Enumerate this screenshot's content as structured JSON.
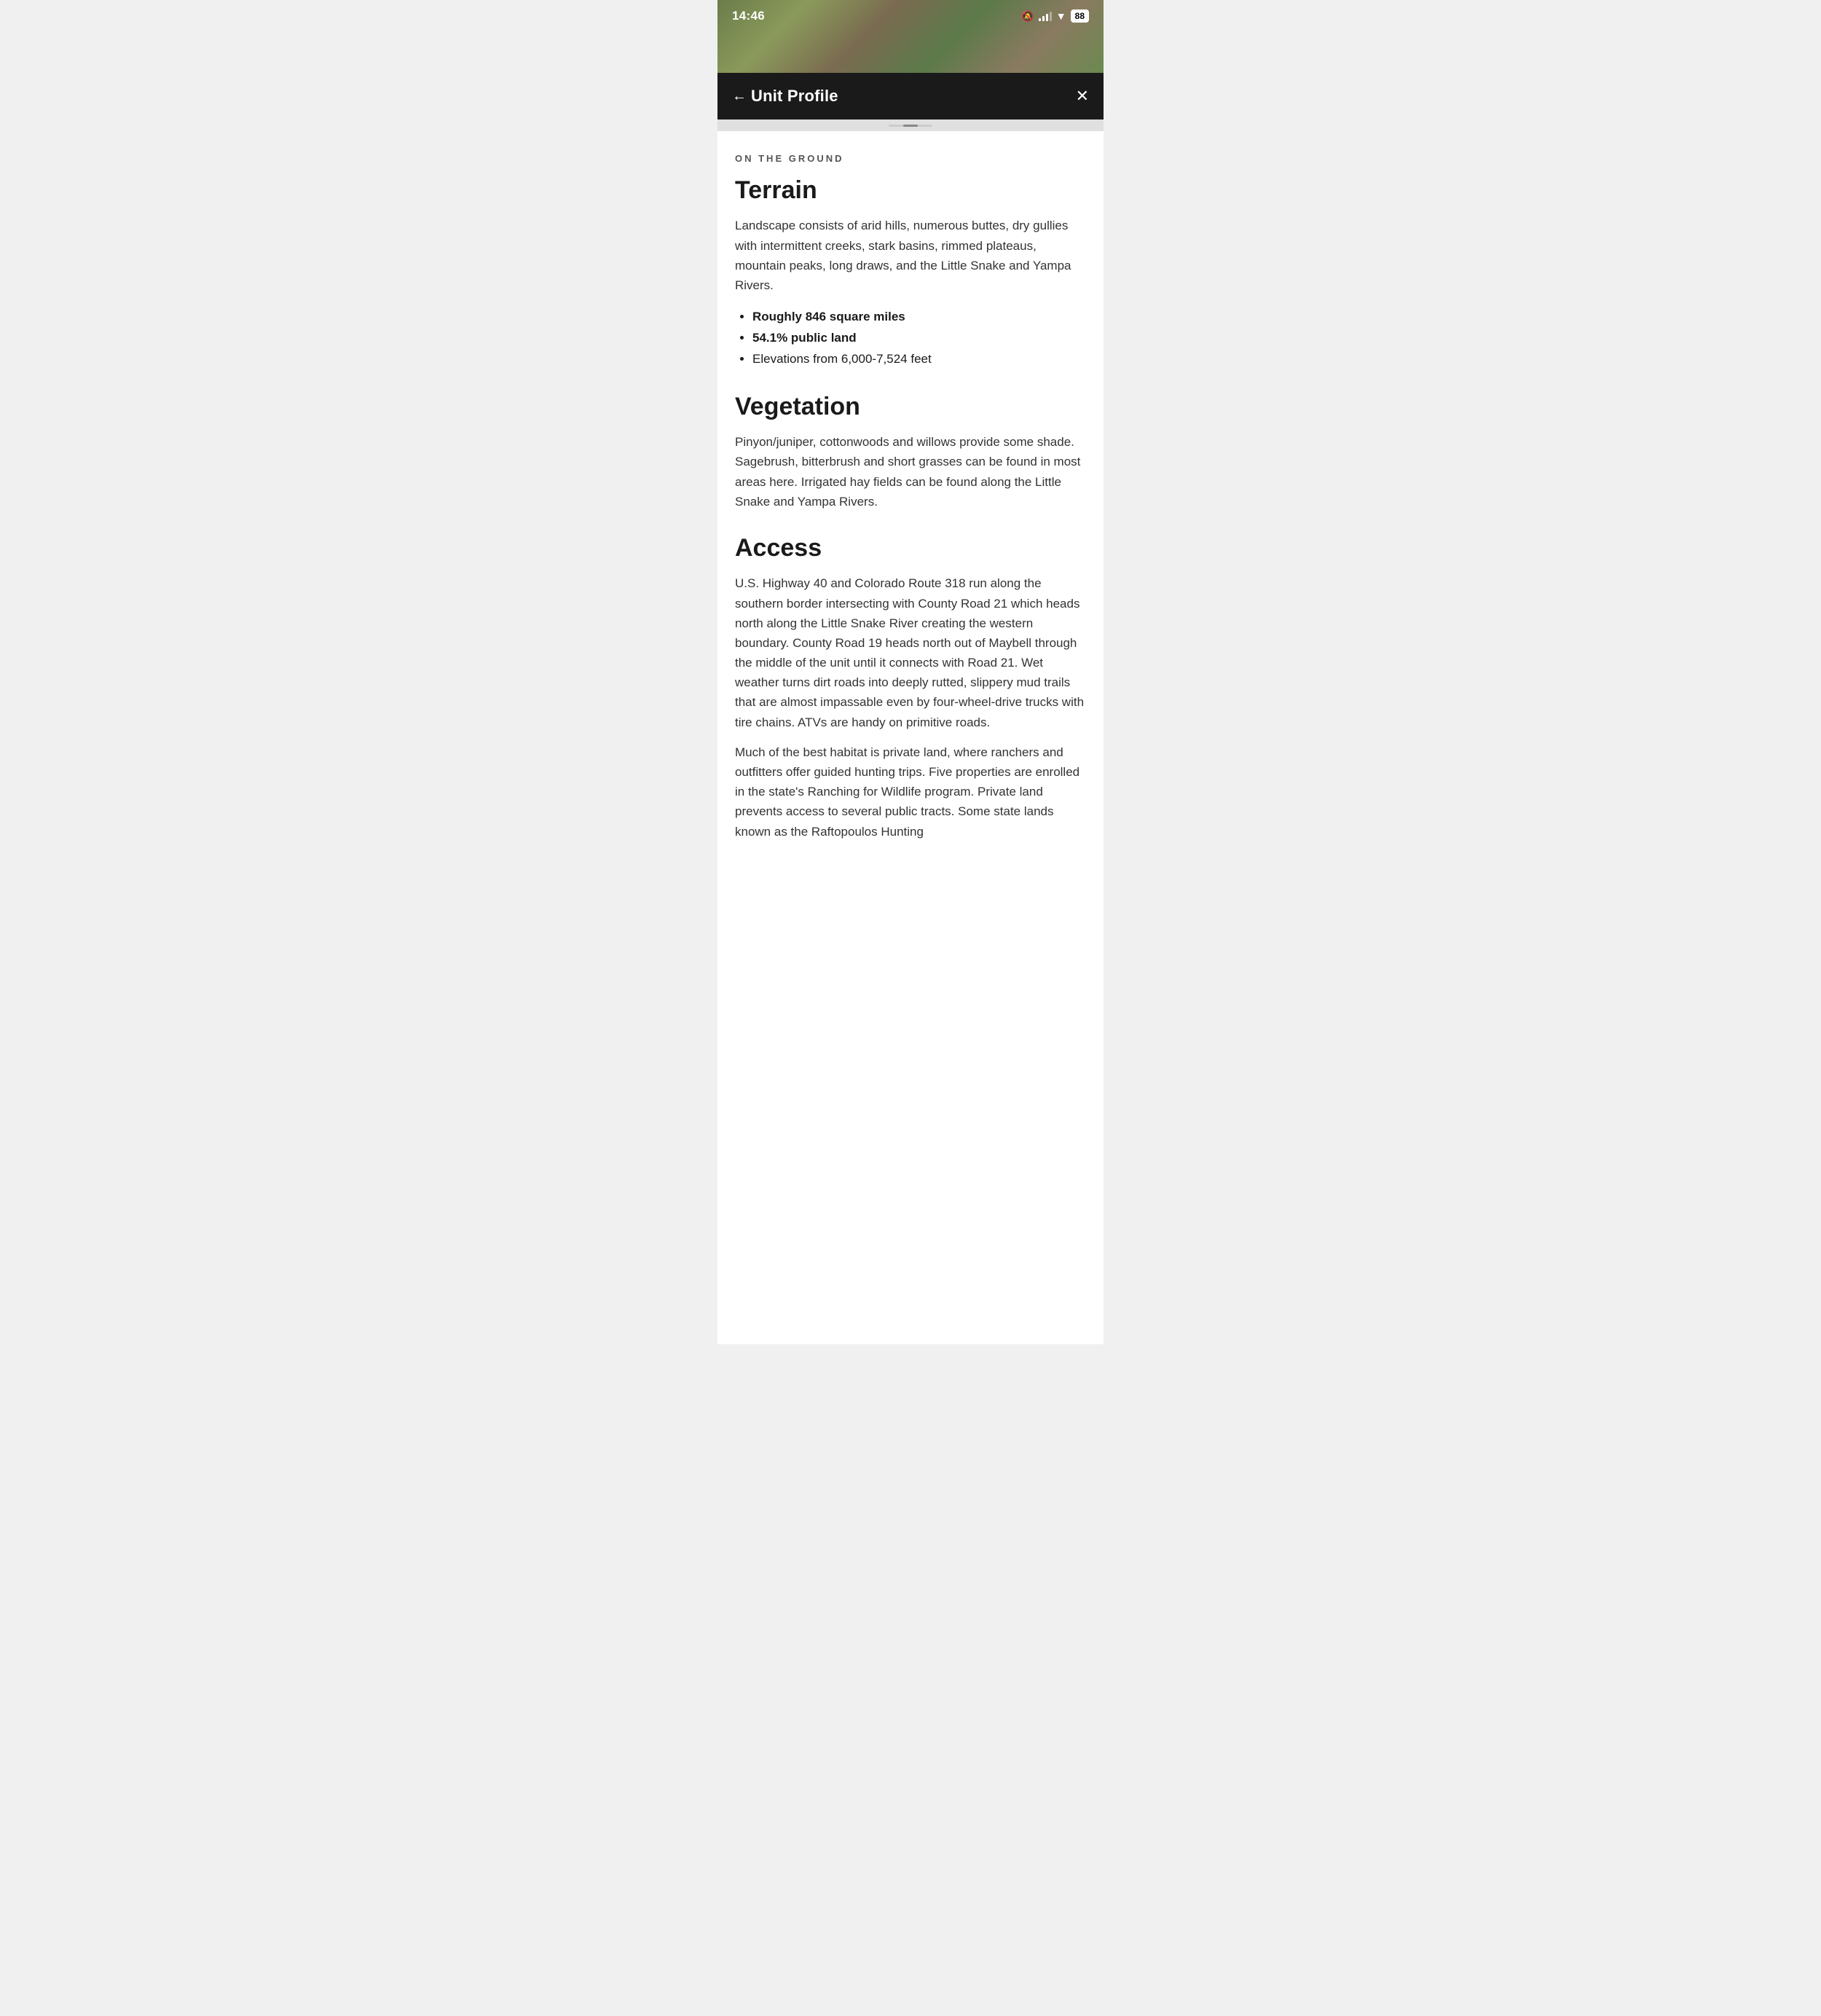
{
  "statusBar": {
    "time": "14:46",
    "batteryLevel": "88",
    "bellIcon": "🔕",
    "wifiIcon": "📶"
  },
  "navBar": {
    "backLabel": "Unit Profile",
    "backIcon": "←",
    "closeIcon": "✕"
  },
  "sectionLabel": "ON THE GROUND",
  "terrain": {
    "heading": "Terrain",
    "description": "Landscape consists of arid hills, numerous buttes, dry gullies with intermittent creeks, stark basins, rimmed plateaus, mountain peaks, long draws, and  the Little Snake and Yampa Rivers.",
    "bullets": [
      "Roughly 846 square miles",
      "54.1% public land",
      "Elevations from 6,000-7,524 feet"
    ]
  },
  "vegetation": {
    "heading": "Vegetation",
    "description": "Pinyon/juniper, cottonwoods and willows provide some shade. Sagebrush, bitterbrush and short grasses can be found in most areas here. Irrigated hay fields can be found along the Little Snake and Yampa Rivers."
  },
  "access": {
    "heading": "Access",
    "paragraph1": "U.S. Highway 40 and Colorado Route 318 run along the southern border intersecting with County Road 21 which heads north along the Little Snake River creating the western boundary. County Road 19 heads north out of Maybell through the middle of the unit until it connects with Road 21. Wet weather turns dirt roads into deeply rutted, slippery mud trails that are almost impassable even by four-wheel-drive trucks with tire chains. ATVs are handy on primitive roads.",
    "paragraph2": "Much of the best habitat is private land, where ranchers and outfitters offer guided hunting trips. Five properties are enrolled in the state's Ranching for Wildlife program. Private land prevents access to several public tracts. Some state lands known as the Raftopoulos Hunting"
  }
}
